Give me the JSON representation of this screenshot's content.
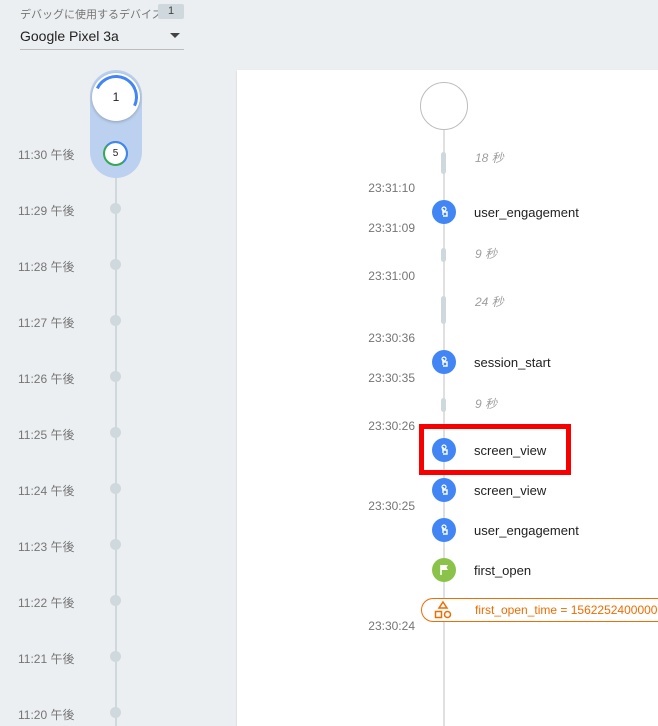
{
  "device": {
    "label": "デバッグに使用するデバイス",
    "count": "1",
    "selected": "Google Pixel 3a"
  },
  "minutes": {
    "total_bubble": "1",
    "current_count": "5",
    "labels": [
      "11:30 午後",
      "11:29 午後",
      "11:28 午後",
      "11:27 午後",
      "11:26 午後",
      "11:25 午後",
      "11:24 午後",
      "11:23 午後",
      "11:22 午後",
      "11:21 午後",
      "11:20 午後"
    ]
  },
  "stream": {
    "gaps": [
      "18 秒",
      "9 秒",
      "24 秒",
      "9 秒"
    ],
    "timestamps": [
      "23:31:10",
      "23:31:09",
      "23:31:00",
      "23:30:36",
      "23:30:35",
      "23:30:26",
      "23:30:25",
      "23:30:24"
    ],
    "events": [
      "user_engagement",
      "session_start",
      "screen_view",
      "screen_view",
      "user_engagement",
      "first_open"
    ],
    "user_property": "first_open_time = 1562252400000"
  },
  "colors": {
    "accent_blue": "#4285f4",
    "event_green": "#8bc34a",
    "property_orange": "#ef6c00",
    "highlight_red": "#f80000"
  }
}
